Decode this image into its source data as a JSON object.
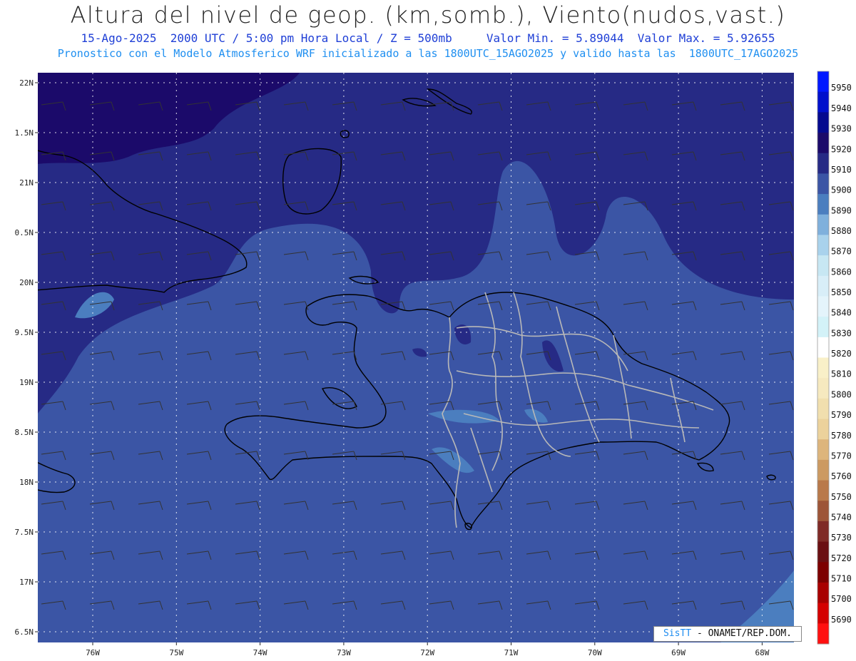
{
  "header": {
    "title": "Altura del nivel de geop. (km,somb.), Viento(nudos,vast.)",
    "line2_left": "15-Ago-2025  2000 UTC / 5:00 pm Hora Local / Z = 500mb",
    "line2_right": "Valor Min. = 5.89044  Valor Max. = 5.92655",
    "line3": "Pronostico con el Modelo Atmosferico WRF inicializado a las 1800UTC_15AGO2025 y valido hasta las  1800UTC_17AGO2025"
  },
  "axes": {
    "lat_labels": [
      "22N",
      "1.5N",
      "21N",
      "0.5N",
      "20N",
      "9.5N",
      "19N",
      "8.5N",
      "18N",
      "7.5N",
      "17N",
      "6.5N"
    ],
    "lon_labels": [
      "76W",
      "75W",
      "74W",
      "73W",
      "72W",
      "71W",
      "70W",
      "69W",
      "68W"
    ]
  },
  "colorbar": {
    "levels": [
      5950,
      5940,
      5930,
      5920,
      5910,
      5900,
      5890,
      5880,
      5870,
      5860,
      5850,
      5840,
      5830,
      5820,
      5810,
      5800,
      5790,
      5780,
      5770,
      5760,
      5750,
      5740,
      5730,
      5720,
      5710,
      5700,
      5690
    ],
    "colors": [
      "#0018ff",
      "#0010cc",
      "#050a8f",
      "#1b0a6a",
      "#262a85",
      "#3b55a5",
      "#4b7ebf",
      "#7fb0dc",
      "#a9d2ec",
      "#c7e7f3",
      "#d8eef8",
      "#e4f4fb",
      "#d3f2f8",
      "#ffffff",
      "#f9f0c8",
      "#f6e9bf",
      "#f1dfae",
      "#ecd29c",
      "#ddb57c",
      "#cc9a62",
      "#b9794a",
      "#9d5538",
      "#7f2a26",
      "#6a0f12",
      "#7d0000",
      "#a80000",
      "#d40000",
      "#ff1010"
    ]
  },
  "colors": {
    "field_main": "#3b55a5",
    "field_high": "#262a85",
    "field_higher": "#1b0a6a",
    "field_low": "#4b7ebf",
    "border_dr": "#b8b8b8",
    "coast": "#000000"
  },
  "credit": {
    "brand": "SisTT",
    "text": "- ONAMET/REP.DOM."
  }
}
